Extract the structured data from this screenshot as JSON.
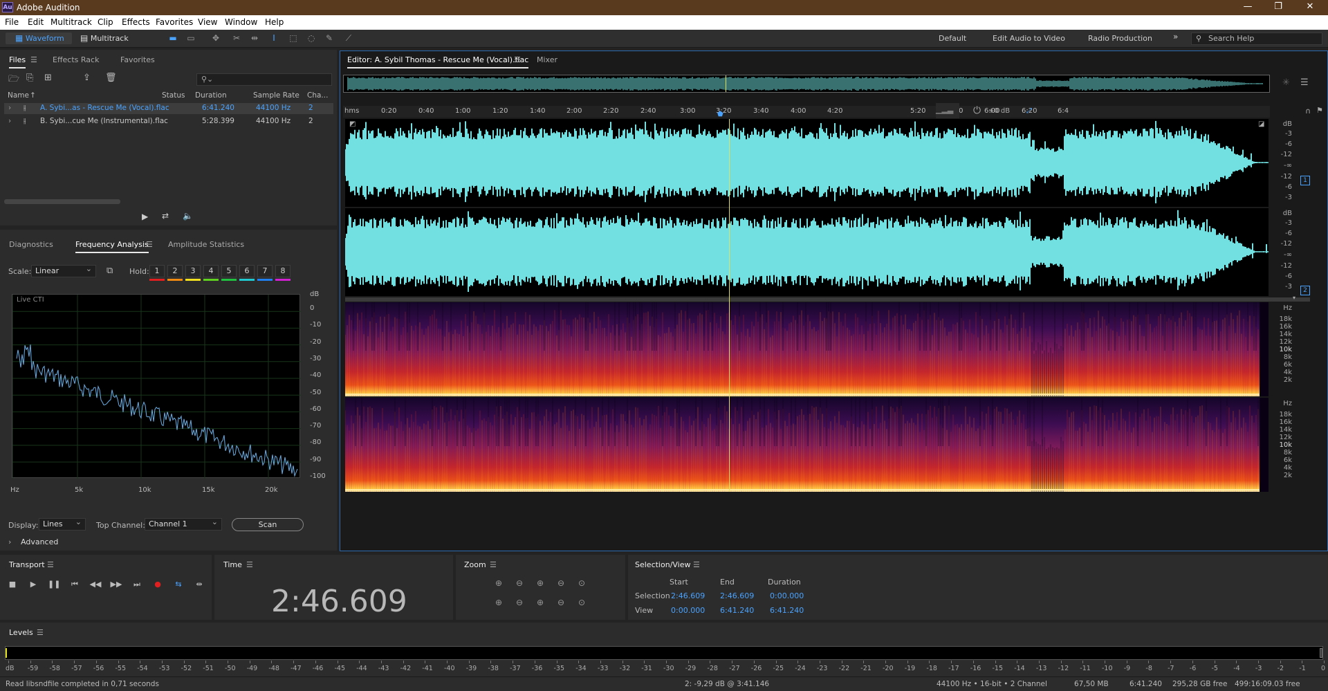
{
  "app": {
    "title": "Adobe Audition",
    "logo": "Au"
  },
  "menu": [
    "File",
    "Edit",
    "Multitrack",
    "Clip",
    "Effects",
    "Favorites",
    "View",
    "Window",
    "Help"
  ],
  "toolbar": {
    "waveform": "Waveform",
    "multitrack": "Multitrack"
  },
  "workspaces": [
    "Default",
    "Edit Audio to Video",
    "Radio Production"
  ],
  "search_placeholder": "Search Help",
  "files_panel": {
    "tabs": [
      "Files",
      "Effects Rack",
      "Favorites"
    ],
    "columns": [
      "Name",
      "Status",
      "Duration",
      "Sample Rate",
      "Cha..."
    ],
    "rows": [
      {
        "name": "A. Sybi...as - Rescue Me (Vocal).flac",
        "duration": "6:41.240",
        "rate": "44100 Hz",
        "channels": "2"
      },
      {
        "name": "B. Sybi...cue Me (Instrumental).flac",
        "duration": "5:28.399",
        "rate": "44100 Hz",
        "channels": "2"
      }
    ]
  },
  "analysis_panel": {
    "tabs": [
      "Diagnostics",
      "Frequency Analysis",
      "Amplitude Statistics"
    ],
    "scale_label": "Scale:",
    "scale_value": "Linear",
    "hold_label": "Hold:",
    "hold": [
      "1",
      "2",
      "3",
      "4",
      "5",
      "6",
      "7",
      "8"
    ],
    "hold_colors": [
      "#e02020",
      "#f08a10",
      "#f0e020",
      "#60d020",
      "#20c040",
      "#20c8d0",
      "#2080f0",
      "#d020d0"
    ],
    "plot_label": "Live CTI",
    "db_label": "dB",
    "db_ticks": [
      "0",
      "-10",
      "-20",
      "-30",
      "-40",
      "-50",
      "-60",
      "-70",
      "-80",
      "-90",
      "-100"
    ],
    "hz_ticks": [
      "Hz",
      "5k",
      "10k",
      "15k",
      "20k"
    ],
    "display_label": "Display:",
    "display_value": "Lines",
    "top_channel_label": "Top Channel:",
    "top_channel_value": "Channel 1",
    "scan": "Scan",
    "advanced": "Advanced"
  },
  "editor": {
    "tab": "Editor: A. Sybil Thomas - Rescue Me (Vocal).flac",
    "mixer": "Mixer",
    "ruler": [
      "hms",
      "0:20",
      "0:40",
      "1:00",
      "1:20",
      "1:40",
      "2:00",
      "2:20",
      "2:40",
      "3:00",
      "3:20",
      "3:40",
      "4:00",
      "4:20",
      "5:20",
      "5:40",
      "6:00",
      "6:20",
      "6:4"
    ],
    "gain": "+0 dB",
    "wave_db": [
      "dB",
      "-3",
      "-6",
      "-12",
      "-∞",
      "-12",
      "-6",
      "-3"
    ],
    "spec_hz": [
      "Hz",
      "18k",
      "16k",
      "14k",
      "12k",
      "10k",
      "8k",
      "6k",
      "4k",
      "2k"
    ],
    "channels": [
      "1",
      "2"
    ],
    "wave_color": "#72e0e0"
  },
  "transport": {
    "title": "Transport"
  },
  "time": {
    "title": "Time",
    "value": "2:46.609"
  },
  "zoom": {
    "title": "Zoom"
  },
  "selection_view": {
    "title": "Selection/View",
    "headers": [
      "Start",
      "End",
      "Duration"
    ],
    "selection_label": "Selection",
    "view_label": "View",
    "selection": [
      "2:46.609",
      "2:46.609",
      "0:00.000"
    ],
    "view": [
      "0:00.000",
      "6:41.240",
      "6:41.240"
    ]
  },
  "levels": {
    "title": "Levels",
    "ticks": [
      "dB",
      "-59",
      "-58",
      "-57",
      "-56",
      "-55",
      "-54",
      "-53",
      "-52",
      "-51",
      "-50",
      "-49",
      "-48",
      "-47",
      "-46",
      "-45",
      "-44",
      "-43",
      "-42",
      "-41",
      "-40",
      "-39",
      "-38",
      "-37",
      "-36",
      "-35",
      "-34",
      "-33",
      "-32",
      "-31",
      "-30",
      "-29",
      "-28",
      "-27",
      "-26",
      "-25",
      "-24",
      "-23",
      "-22",
      "-21",
      "-20",
      "-19",
      "-18",
      "-17",
      "-16",
      "-15",
      "-14",
      "-13",
      "-12",
      "-11",
      "-10",
      "-9",
      "-8",
      "-7",
      "-6",
      "-5",
      "-4",
      "-3",
      "-2",
      "-1",
      "0"
    ]
  },
  "status": {
    "left": "Read libsndfile completed in 0,71 seconds",
    "cursor": "2: -9,29 dB @ 3:41.146",
    "format": "44100 Hz • 16-bit • 2 Channel",
    "size": "67,50 MB",
    "duration": "6:41.240",
    "free": "295,28 GB free",
    "time_free": "499:16:09.03 free"
  }
}
